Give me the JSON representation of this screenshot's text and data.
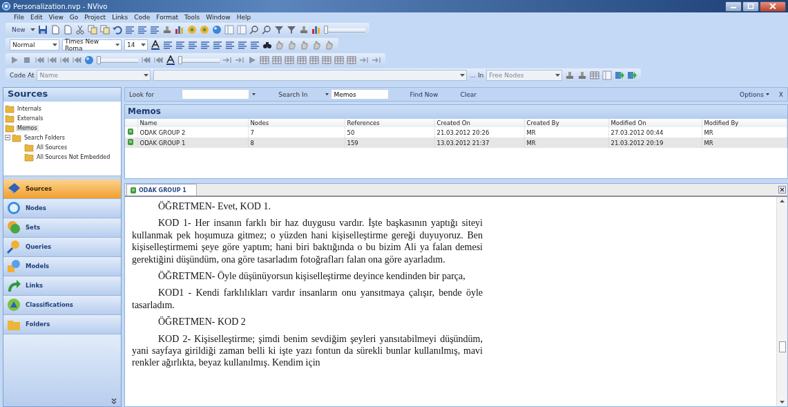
{
  "window": {
    "title": "Personalization.nvp - NVivo"
  },
  "menu": [
    "File",
    "Edit",
    "View",
    "Go",
    "Project",
    "Links",
    "Code",
    "Format",
    "Tools",
    "Window",
    "Help"
  ],
  "toolbars": [
    {
      "items": [
        {
          "kind": "button",
          "text": "New"
        },
        {
          "kind": "icons"
        },
        {
          "kind": "slider",
          "level": 0
        }
      ]
    },
    {
      "items": [
        {
          "kind": "combo",
          "text": "Normal",
          "disabled": false
        },
        {
          "kind": "combo",
          "text": "Times New Roma",
          "disabled": false
        },
        {
          "kind": "combo",
          "text": "14",
          "disabled": false
        },
        {
          "kind": "icons"
        }
      ]
    },
    {
      "items": [
        {
          "kind": "icons"
        },
        {
          "kind": "slider",
          "level": 0
        },
        {
          "kind": "icons"
        },
        {
          "kind": "slider",
          "level": 0
        },
        {
          "kind": "icons"
        }
      ]
    },
    {
      "items": [
        {
          "kind": "label",
          "text": "Code At"
        },
        {
          "kind": "combo",
          "text": "Name",
          "disabled": true
        },
        {
          "kind": "wide",
          "disabled": true
        },
        {
          "kind": "label",
          "text": "... In"
        },
        {
          "kind": "combo",
          "text": "Free Nodes",
          "disabled": true
        },
        {
          "kind": "icons"
        }
      ]
    }
  ],
  "sidebar": {
    "title": "Sources",
    "tree": [
      {
        "label": "Internals",
        "selected": false
      },
      {
        "label": "Externals",
        "selected": false
      },
      {
        "label": "Memos",
        "selected": true
      },
      {
        "label": "Search Folders",
        "selected": false,
        "expanded": true,
        "children": [
          {
            "label": "All Sources",
            "selected": false
          },
          {
            "label": "All Sources Not Embedded",
            "selected": false
          }
        ]
      }
    ],
    "nav": [
      {
        "label": "Sources",
        "selected": true
      },
      {
        "label": "Nodes",
        "selected": false
      },
      {
        "label": "Sets",
        "selected": false
      },
      {
        "label": "Queries",
        "selected": false
      },
      {
        "label": "Models",
        "selected": false
      },
      {
        "label": "Links",
        "selected": false
      },
      {
        "label": "Classifications",
        "selected": false
      },
      {
        "label": "Folders",
        "selected": false
      }
    ]
  },
  "find_bar": {
    "look_for_label": "Look for",
    "search_in_label": "Search In",
    "search_in": "Memos",
    "find_now": "Find Now",
    "clear": "Clear",
    "options": "Options",
    "close": "X"
  },
  "list": {
    "title": "Memos",
    "columns": [
      "Name",
      "Nodes",
      "References",
      "Created On",
      "Created By",
      "Modified On",
      "Modified By"
    ],
    "rows": [
      {
        "selected": false,
        "cells": [
          "ODAK GROUP 2",
          "7",
          "50",
          "21.03.2012 20:26",
          "MR",
          "27.03.2012 00:44",
          "MR"
        ]
      },
      {
        "selected": true,
        "cells": [
          "ODAK GROUP 1",
          "8",
          "159",
          "13.03.2012 21:37",
          "MR",
          "21.03.2012 20:19",
          "MR"
        ]
      }
    ]
  },
  "document": {
    "tabs": [
      {
        "label": "ODAK GROUP 1",
        "selected": true
      }
    ],
    "paragraphs": [
      "ÖĞRETMEN- Evet, KOD 1.",
      "KOD 1- Her insanın farklı bir haz duygusu vardır. İşte başkasının yaptığı siteyi kullanmak pek hoşumuza gitmez; o yüzden hani kişiselleştirme gereği duyuyoruz. Ben kişiselleştirmemi şeye göre yaptım; hani biri baktığında o bu bizim Ali ya falan demesi gerektiğini düşündüm, ona göre tasarladım fotoğrafları falan ona göre ayarladım.",
      "ÖĞRETMEN- Öyle düşünüyorsun kişiselleştirme deyince kendinden bir parça,",
      "KOD1 - Kendi farklılıkları vardır insanların onu yansıtmaya çalışır, bende öyle tasarladım.",
      "ÖĞRETMEN- KOD 2",
      "KOD 2- Kişiselleştirme; şimdi benim sevdiğim şeyleri yansıtabilmeyi düşündüm, yani sayfaya girildiği zaman belli ki işte yazı fontun da sürekli bunlar kullanılmış, mavi renkler ağırlıkta, beyaz kullanılmış. Kendim için"
    ]
  }
}
